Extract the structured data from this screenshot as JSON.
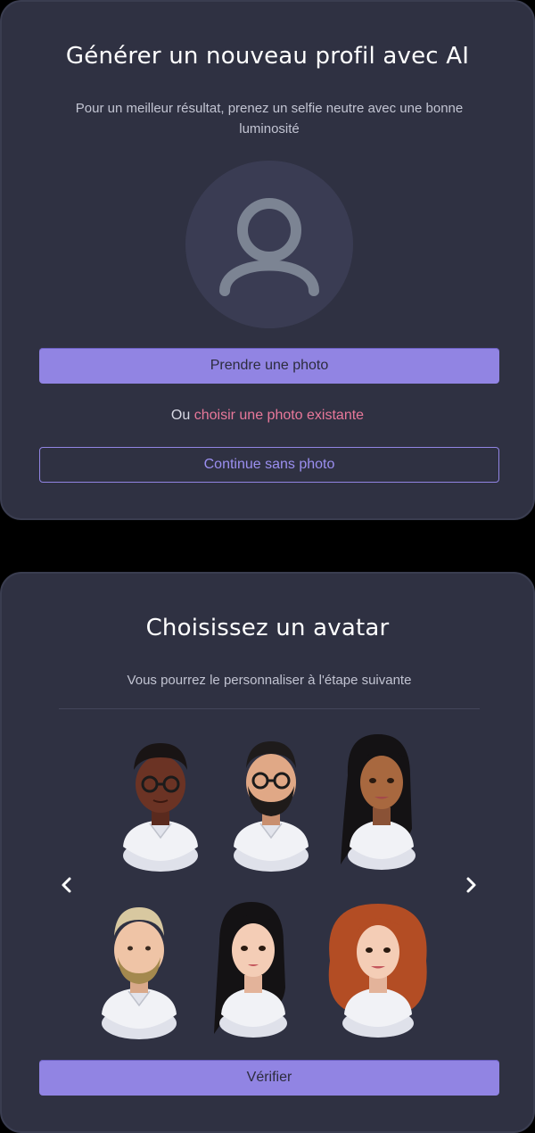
{
  "upload": {
    "title": "Générer un nouveau profil avec AI",
    "subtitle": "Pour un meilleur résultat, prenez un selfie neutre avec une bonne luminosité",
    "take_photo_label": "Prendre une photo",
    "or_prefix": "Ou",
    "choose_existing_label": "choisir une photo existante",
    "continue_label": "Continue sans photo",
    "placeholder_icon": "user-icon"
  },
  "avatars": {
    "title": "Choisissez un avatar",
    "subtitle": "Vous pourrez le personnaliser à l'étape suivante",
    "prev_icon": "chevron-left-icon",
    "next_icon": "chevron-right-icon",
    "verify_label": "Vérifier"
  },
  "colors": {
    "card_bg": "#2f3142",
    "accent": "#9184e3",
    "link": "#e8789a"
  }
}
